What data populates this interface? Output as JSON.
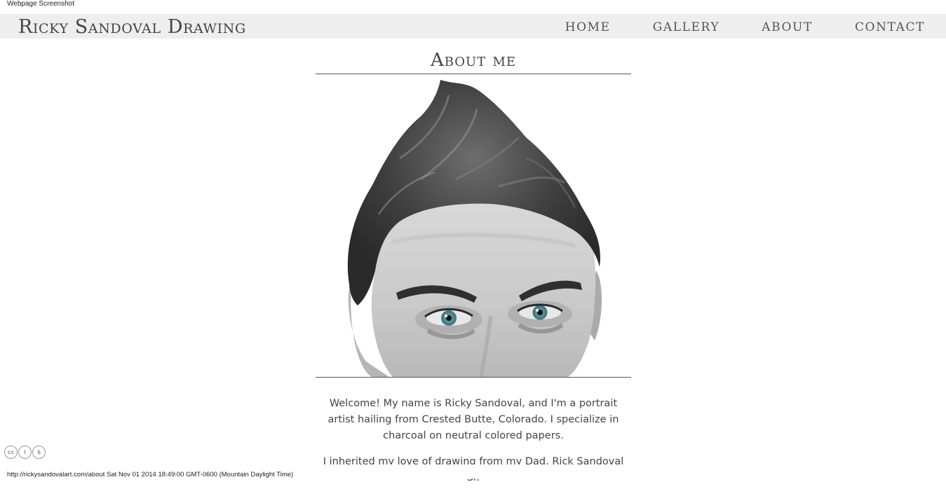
{
  "capture": {
    "label": "Webpage Screenshot",
    "footer": "http://rickysandovalart.com/about Sat Nov 01 2014 18:49:00 GMT-0600 (Mountain Daylight Time)"
  },
  "site": {
    "title": "Ricky Sandoval Drawing"
  },
  "nav": {
    "items": [
      {
        "label": "HOME"
      },
      {
        "label": "GALLERY"
      },
      {
        "label": "ABOUT"
      },
      {
        "label": "CONTACT"
      }
    ]
  },
  "page": {
    "title": "About me",
    "paragraphs": [
      "Welcome! My name is Ricky Sandoval, and I'm a portrait artist hailing from Crested Butte, Colorado. I specialize in charcoal on neutral colored papers.",
      "I inherited my love of drawing from my Dad, Rick Sandoval Sr."
    ]
  },
  "license": {
    "badges": [
      {
        "icon": "cc-icon",
        "glyph": "cc"
      },
      {
        "icon": "attribution-icon",
        "glyph": "i"
      },
      {
        "icon": "noncommercial-icon",
        "glyph": "$"
      }
    ]
  },
  "colors": {
    "topbar_bg": "#eeeeee",
    "text": "#444444",
    "eye": "#6aa0a8"
  }
}
